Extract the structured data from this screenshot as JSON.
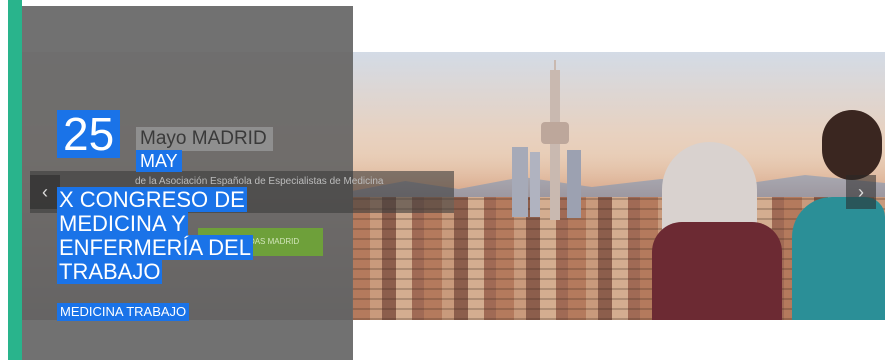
{
  "accent_color": "#29b48c",
  "highlight_color": "#1a73e8",
  "slide": {
    "date_day": "25",
    "date_month_word": "Mayo MADRID",
    "date_month": "MAY",
    "subtitle": "de la Asociación Española de Especialistas de Medicina",
    "headline": "X CONGRESO DE MEDICINA Y ENFERMERÍA DEL TRABAJO",
    "button_label": "JORNADAS MADRID",
    "tag": "MEDICINA TRABAJO"
  },
  "controls": {
    "prev_icon": "chevron-left-icon",
    "prev_glyph": "‹",
    "next_icon": "chevron-right-icon",
    "next_glyph": "›"
  }
}
